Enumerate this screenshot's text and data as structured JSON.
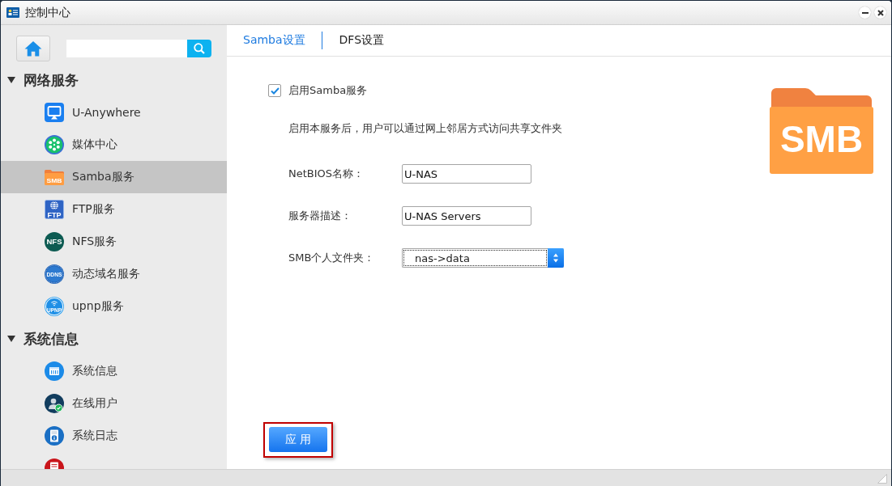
{
  "window": {
    "title": "控制中心"
  },
  "sidebar": {
    "sections": [
      {
        "title": "网络服务",
        "expanded": true,
        "items": [
          {
            "kind": "airplay",
            "label": "U-Anywhere",
            "selected": false
          },
          {
            "kind": "media",
            "label": "媒体中心",
            "selected": false
          },
          {
            "kind": "smb",
            "icon_text": "SMB",
            "label": "Samba服务",
            "selected": true
          },
          {
            "kind": "ftp",
            "icon_text": "FTP",
            "label": "FTP服务",
            "selected": false
          },
          {
            "kind": "nfs",
            "icon_text": "NFS",
            "label": "NFS服务",
            "selected": false
          },
          {
            "kind": "ddns",
            "icon_text": "DDNS",
            "label": "动态域名服务",
            "selected": false
          },
          {
            "kind": "upnp",
            "icon_text": "UPNP",
            "label": "upnp服务",
            "selected": false
          }
        ]
      },
      {
        "title": "系统信息",
        "expanded": true,
        "items": [
          {
            "kind": "sysinfo",
            "label": "系统信息",
            "selected": false
          },
          {
            "kind": "users",
            "label": "在线用户",
            "selected": false
          },
          {
            "kind": "log",
            "label": "系统日志",
            "selected": false
          },
          {
            "kind": "error-log",
            "selected": false
          }
        ]
      }
    ]
  },
  "tabs": [
    {
      "label": "Samba设置",
      "selected": true
    },
    {
      "label": "DFS设置",
      "selected": false
    }
  ],
  "samba": {
    "enable": {
      "label": "启用Samba服务",
      "checked": true
    },
    "description": "启用本服务后，用户可以通过网上邻居方式访问共享文件夹",
    "fields": [
      {
        "kind": "text",
        "label": "NetBIOS名称：",
        "value": "U-NAS"
      },
      {
        "kind": "text",
        "label": "服务器描述：",
        "value": "U-NAS Servers"
      },
      {
        "kind": "select",
        "label": "SMB个人文件夹：",
        "value": "nas->data"
      }
    ]
  },
  "hero_icon": {
    "text": "SMB"
  },
  "apply_button": {
    "label": "应 用",
    "highlighted": true
  }
}
